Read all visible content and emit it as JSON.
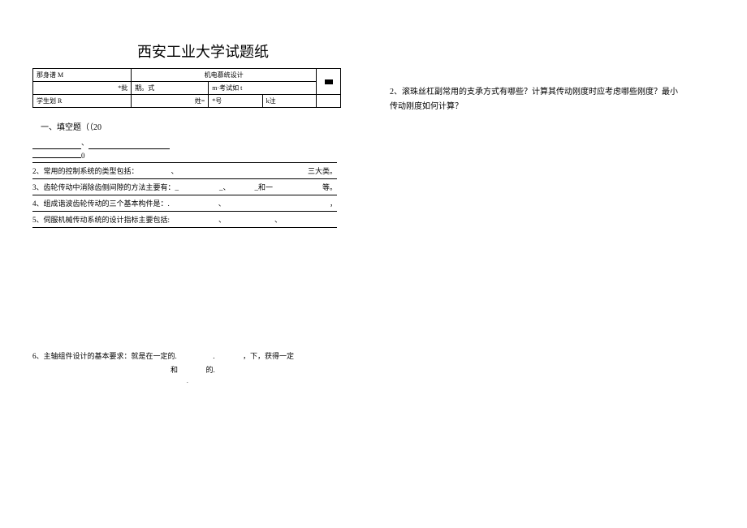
{
  "title": "西安工业大学试题纸",
  "header_table": {
    "r1c1": "那身谱 M",
    "r1c2": "机电慕统设计",
    "r2c1": "*批",
    "r2c2": "期。式",
    "r2c3": "m·考试如 t",
    "r3c1": "学生划 R",
    "r3c2": "姓=",
    "r3c3": "*号",
    "r3c4": "k注"
  },
  "section1": "一、填空题（（20",
  "line_zero": "0",
  "q2": "2、常用的控制系统的类型包括：",
  "q2_tail": "三大类。",
  "q3": "3、齿轮传动中消除齿侧间隙的方法主要有：_",
  "q3_mid": "_、",
  "q3_and": "_和一",
  "q3_tail": "等。",
  "q4": "4、组成谐波齿轮传动的三个基本构件是：.",
  "q5": "5、伺服机械传动系统的设计指标主要包括:",
  "q6_a": "6、主轴组件设计的基本要求：就是在一定的.",
  "q6_b": ".",
  "q6_c": "，下，获得一定",
  "q6_d": "和",
  "q6_e": "的.",
  "right_q2": "2、滚珠丝杠副常用的支承方式有哪些？计算其传动刚度时应考虑哪些刚度？最小传动刚度如何计算？",
  "sep_dot": "、",
  "sep_comma": "，"
}
